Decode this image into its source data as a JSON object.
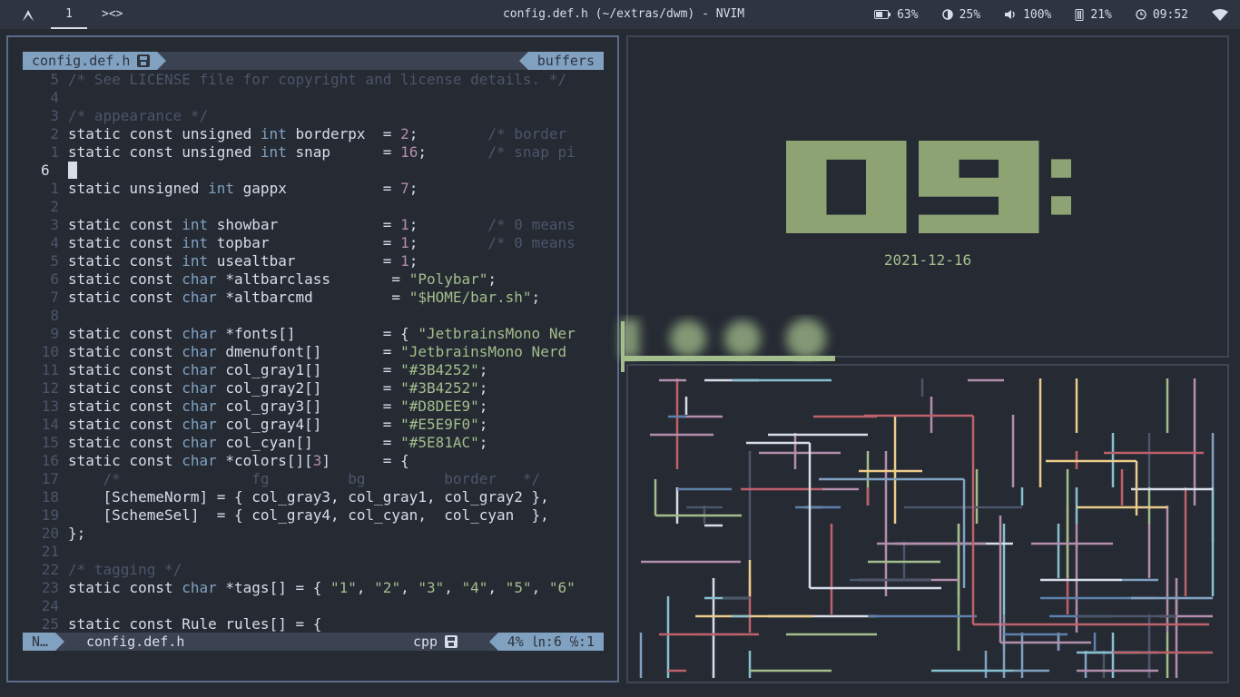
{
  "topbar": {
    "logo": "arch-icon",
    "workspace": "1",
    "layout": "><>",
    "title": "config.def.h (~/extras/dwm) - NVIM",
    "battery": "63%",
    "brightness": "25%",
    "volume": "100%",
    "memory": "21%",
    "time": "09:52",
    "colors": {
      "bg": "#2e3440",
      "fg": "#d8dee9"
    }
  },
  "editor": {
    "tab_name": "config.def.h",
    "buffers_label": "buffers",
    "lines": [
      {
        "n": "5",
        "segs": [
          [
            "cm",
            "/* See LICENSE file for copyright and license details. */"
          ]
        ]
      },
      {
        "n": "4",
        "segs": []
      },
      {
        "n": "3",
        "segs": [
          [
            "cm",
            "/* appearance */"
          ]
        ]
      },
      {
        "n": "2",
        "segs": [
          [
            "tx",
            "static const unsigned "
          ],
          [
            "kw",
            "int"
          ],
          [
            "tx",
            " borderpx  = "
          ],
          [
            "num",
            "2"
          ],
          [
            "tx",
            ";        "
          ],
          [
            "cm",
            "/* border"
          ]
        ]
      },
      {
        "n": "1",
        "segs": [
          [
            "tx",
            "static const unsigned "
          ],
          [
            "kw",
            "int"
          ],
          [
            "tx",
            " snap      = "
          ],
          [
            "num",
            "16"
          ],
          [
            "tx",
            ";       "
          ],
          [
            "cm",
            "/* snap pi"
          ]
        ]
      },
      {
        "n": "6",
        "cur": true,
        "segs": []
      },
      {
        "n": "1",
        "segs": [
          [
            "tx",
            "static unsigned "
          ],
          [
            "kw",
            "int"
          ],
          [
            "tx",
            " gappx           = "
          ],
          [
            "num",
            "7"
          ],
          [
            "tx",
            ";"
          ]
        ]
      },
      {
        "n": "2",
        "segs": []
      },
      {
        "n": "3",
        "segs": [
          [
            "tx",
            "static const "
          ],
          [
            "kw",
            "int"
          ],
          [
            "tx",
            " showbar            = "
          ],
          [
            "num",
            "1"
          ],
          [
            "tx",
            ";        "
          ],
          [
            "cm",
            "/* 0 means"
          ]
        ]
      },
      {
        "n": "4",
        "segs": [
          [
            "tx",
            "static const "
          ],
          [
            "kw",
            "int"
          ],
          [
            "tx",
            " topbar             = "
          ],
          [
            "num",
            "1"
          ],
          [
            "tx",
            ";        "
          ],
          [
            "cm",
            "/* 0 means"
          ]
        ]
      },
      {
        "n": "5",
        "segs": [
          [
            "tx",
            "static const "
          ],
          [
            "kw",
            "int"
          ],
          [
            "tx",
            " usealtbar          = "
          ],
          [
            "num",
            "1"
          ],
          [
            "tx",
            ";"
          ]
        ]
      },
      {
        "n": "6",
        "segs": [
          [
            "tx",
            "static const "
          ],
          [
            "kw",
            "char"
          ],
          [
            "tx",
            " *altbarclass       = "
          ],
          [
            "str",
            "\"Polybar\""
          ],
          [
            "tx",
            ";"
          ]
        ]
      },
      {
        "n": "7",
        "segs": [
          [
            "tx",
            "static const "
          ],
          [
            "kw",
            "char"
          ],
          [
            "tx",
            " *altbarcmd         = "
          ],
          [
            "str",
            "\"$HOME/bar.sh\""
          ],
          [
            "tx",
            ";"
          ]
        ]
      },
      {
        "n": "8",
        "segs": []
      },
      {
        "n": "9",
        "segs": [
          [
            "tx",
            "static const "
          ],
          [
            "kw",
            "char"
          ],
          [
            "tx",
            " *fonts[]          = { "
          ],
          [
            "str",
            "\"JetbrainsMono Ner"
          ]
        ]
      },
      {
        "n": "10",
        "segs": [
          [
            "tx",
            "static const "
          ],
          [
            "kw",
            "char"
          ],
          [
            "tx",
            " dmenufont[]       = "
          ],
          [
            "str",
            "\"JetbrainsMono Nerd"
          ]
        ]
      },
      {
        "n": "11",
        "segs": [
          [
            "tx",
            "static const "
          ],
          [
            "kw",
            "char"
          ],
          [
            "tx",
            " col_gray1[]       = "
          ],
          [
            "str",
            "\"#3B4252\""
          ],
          [
            "tx",
            ";"
          ]
        ]
      },
      {
        "n": "12",
        "segs": [
          [
            "tx",
            "static const "
          ],
          [
            "kw",
            "char"
          ],
          [
            "tx",
            " col_gray2[]       = "
          ],
          [
            "str",
            "\"#3B4252\""
          ],
          [
            "tx",
            ";"
          ]
        ]
      },
      {
        "n": "13",
        "segs": [
          [
            "tx",
            "static const "
          ],
          [
            "kw",
            "char"
          ],
          [
            "tx",
            " col_gray3[]       = "
          ],
          [
            "str",
            "\"#D8DEE9\""
          ],
          [
            "tx",
            ";"
          ]
        ]
      },
      {
        "n": "14",
        "segs": [
          [
            "tx",
            "static const "
          ],
          [
            "kw",
            "char"
          ],
          [
            "tx",
            " col_gray4[]       = "
          ],
          [
            "str",
            "\"#E5E9F0\""
          ],
          [
            "tx",
            ";"
          ]
        ]
      },
      {
        "n": "15",
        "segs": [
          [
            "tx",
            "static const "
          ],
          [
            "kw",
            "char"
          ],
          [
            "tx",
            " col_cyan[]        = "
          ],
          [
            "str",
            "\"#5E81AC\""
          ],
          [
            "tx",
            ";"
          ]
        ]
      },
      {
        "n": "16",
        "segs": [
          [
            "tx",
            "static const "
          ],
          [
            "kw",
            "char"
          ],
          [
            "tx",
            " *colors[]["
          ],
          [
            "num",
            "3"
          ],
          [
            "tx",
            "]      = {"
          ]
        ]
      },
      {
        "n": "17",
        "segs": [
          [
            "tx",
            "    "
          ],
          [
            "cm",
            "/*               fg         bg         border   */"
          ]
        ]
      },
      {
        "n": "18",
        "segs": [
          [
            "tx",
            "    [SchemeNorm] = { col_gray3, col_gray1, col_gray2 },"
          ]
        ]
      },
      {
        "n": "19",
        "segs": [
          [
            "tx",
            "    [SchemeSel]  = { col_gray4, col_cyan,  col_cyan  },"
          ]
        ]
      },
      {
        "n": "20",
        "segs": [
          [
            "tx",
            "};"
          ]
        ]
      },
      {
        "n": "21",
        "segs": []
      },
      {
        "n": "22",
        "segs": [
          [
            "cm",
            "/* tagging */"
          ]
        ]
      },
      {
        "n": "23",
        "segs": [
          [
            "tx",
            "static const "
          ],
          [
            "kw",
            "char"
          ],
          [
            "tx",
            " *tags[] = { "
          ],
          [
            "str",
            "\"1\""
          ],
          [
            "tx",
            ", "
          ],
          [
            "str",
            "\"2\""
          ],
          [
            "tx",
            ", "
          ],
          [
            "str",
            "\"3\""
          ],
          [
            "tx",
            ", "
          ],
          [
            "str",
            "\"4\""
          ],
          [
            "tx",
            ", "
          ],
          [
            "str",
            "\"5\""
          ],
          [
            "tx",
            ", "
          ],
          [
            "str",
            "\"6\""
          ]
        ]
      },
      {
        "n": "24",
        "segs": []
      },
      {
        "n": "25",
        "segs": [
          [
            "tx",
            "static const Rule rules[] = {"
          ]
        ]
      }
    ],
    "status": {
      "mode": "N…",
      "file": "config.def.h",
      "filetype": "cpp",
      "position": "4% ㏑:6 ℅:1"
    }
  },
  "clock": {
    "time": "09:52",
    "date": "2021-12-16",
    "color": "#8da373"
  },
  "pipes": {
    "colors": [
      "#d8dee9",
      "#81a1c1",
      "#bf616a",
      "#a3be8c",
      "#ebcb8b",
      "#b48ead",
      "#88c0d0",
      "#5e81ac",
      "#4c566a"
    ]
  }
}
